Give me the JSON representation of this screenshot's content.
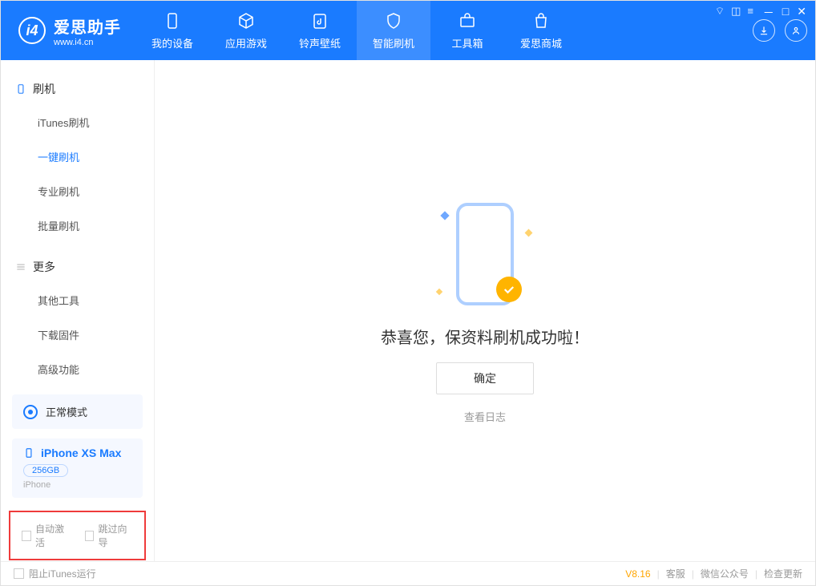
{
  "header": {
    "logo_title": "爱思助手",
    "logo_sub": "www.i4.cn",
    "nav": {
      "device": "我的设备",
      "apps": "应用游戏",
      "ringtones": "铃声壁纸",
      "flash": "智能刷机",
      "toolbox": "工具箱",
      "store": "爱思商城"
    }
  },
  "sidebar": {
    "section1": {
      "title": "刷机"
    },
    "items1": {
      "itunes": "iTunes刷机",
      "onekey": "一键刷机",
      "pro": "专业刷机",
      "batch": "批量刷机"
    },
    "section2": {
      "title": "更多"
    },
    "items2": {
      "other": "其他工具",
      "firmware": "下载固件",
      "advanced": "高级功能"
    },
    "mode": "正常模式",
    "device": {
      "name": "iPhone XS Max",
      "storage": "256GB",
      "type": "iPhone"
    },
    "checks": {
      "auto_activate": "自动激活",
      "skip_guide": "跳过向导"
    }
  },
  "main": {
    "success": "恭喜您，保资料刷机成功啦！",
    "confirm": "确定",
    "view_log": "查看日志"
  },
  "footer": {
    "block_itunes": "阻止iTunes运行",
    "version": "V8.16",
    "customer": "客服",
    "wechat": "微信公众号",
    "update": "检查更新"
  }
}
